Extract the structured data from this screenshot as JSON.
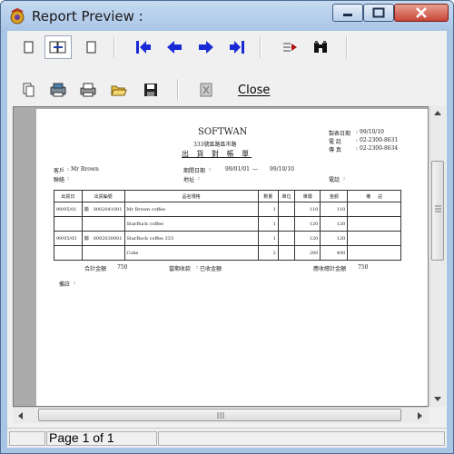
{
  "window": {
    "title": "Report Preview :"
  },
  "toolbar": {
    "close_label": "Close",
    "icons": [
      "single-page-icon",
      "two-page-icon",
      "page-width-icon",
      "first-page-icon",
      "previous-page-icon",
      "next-page-icon",
      "last-page-icon",
      "goto-page-icon",
      "find-icon",
      "copy-icon",
      "print-setup-icon",
      "print-icon",
      "open-icon",
      "save-icon",
      "exit-icon"
    ]
  },
  "report": {
    "company": "SOFTWAN",
    "address": "333號區路區市路",
    "heading": "出 貨 對 帳 單",
    "print_date_label": "製表日期",
    "print_date": "99/10/10",
    "phone_label": "電    話",
    "phone": "02-2300-8631",
    "fax_label": "傳    真",
    "fax": "02-2300-8634",
    "customer_label": "客戶",
    "customer": "Mr Brown",
    "contact_label": "聯絡",
    "period_label": "期間日期",
    "period_from": "99/01/01",
    "period_to": "99/10/10",
    "address_label": "地址",
    "tel_label": "電話",
    "columns": [
      "出貨日",
      "出貨編號",
      "品名規格",
      "數量",
      "單位",
      "單價",
      "金額",
      "備",
      "註"
    ],
    "rows": [
      {
        "date": "99/05/01",
        "flag": "銷",
        "no": "0002041001",
        "item": "Mr Brown coffee",
        "qty": "1",
        "unit": "",
        "price": "110",
        "amount": "110"
      },
      {
        "date": "",
        "flag": "",
        "no": "",
        "item": "StarBuck coffee",
        "qty": "1",
        "unit": "",
        "price": "120",
        "amount": "120"
      },
      {
        "date": "99/05/03",
        "flag": "銷",
        "no": "0002030001",
        "item": "StarBuck coffee  333",
        "qty": "1",
        "unit": "",
        "price": "120",
        "amount": "120"
      },
      {
        "date": "",
        "flag": "",
        "no": "",
        "item": "Coke",
        "qty": "2",
        "unit": "",
        "price": "200",
        "amount": "400"
      }
    ],
    "total_label": "合計金額",
    "total": "750",
    "received_label": "當期收款",
    "received_note": "已收金額",
    "balance_label": "應收總計金額",
    "balance": "750",
    "remarks_label": "備註"
  },
  "status": {
    "page": "Page 1 of 1"
  }
}
